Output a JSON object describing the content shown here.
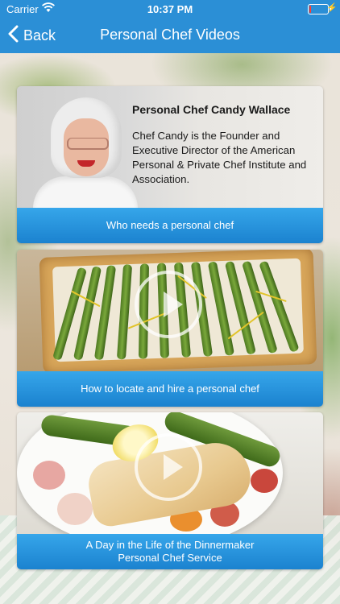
{
  "status_bar": {
    "carrier": "Carrier",
    "time": "10:37 PM",
    "battery_level": 0.08
  },
  "nav": {
    "back_label": "Back",
    "title": "Personal Chef Videos"
  },
  "cards": [
    {
      "heading": "Personal Chef Candy Wallace",
      "description": "Chef Candy is the Founder and Executive Director of the American Personal & Private Chef Institute and Association.",
      "caption": "Who needs a personal chef"
    },
    {
      "caption": "How to locate and hire a personal chef"
    },
    {
      "caption_line1": "A Day in the Life of the Dinnermaker",
      "caption_line2": "Personal Chef Service"
    }
  ],
  "colors": {
    "nav_background": "#2b8fd6",
    "caption_background": "#2596e0",
    "battery_low": "#ff3b30"
  },
  "icons": {
    "back": "chevron-left-icon",
    "wifi": "wifi-icon",
    "battery": "battery-icon",
    "charging": "bolt-icon",
    "play": "play-icon"
  }
}
